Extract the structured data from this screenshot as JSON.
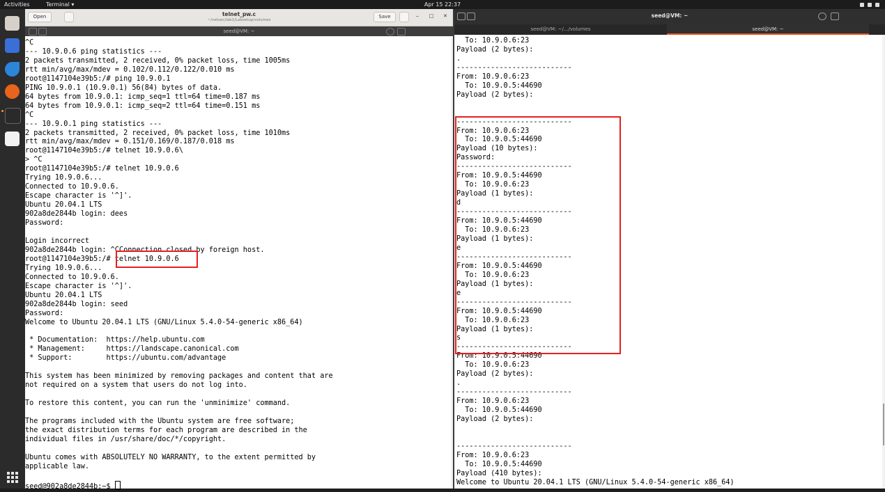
{
  "topbar": {
    "activities": "Activities",
    "app_menu": "Terminal ▾",
    "clock": "Apr 15  22:37"
  },
  "gedit": {
    "open_label": "Open",
    "title": "telnet_pw.c",
    "subtitle": "~/netsec/lab1/Labsetup/volumes",
    "save_label": "Save"
  },
  "left_terminal": {
    "title": "seed@VM: ~",
    "prompt": "seed@902a8de2844b:~$ ",
    "lines": [
      "^C",
      "--- 10.9.0.6 ping statistics ---",
      "2 packets transmitted, 2 received, 0% packet loss, time 1005ms",
      "rtt min/avg/max/mdev = 0.102/0.112/0.122/0.010 ms",
      "root@1147104e39b5:/# ping 10.9.0.1",
      "PING 10.9.0.1 (10.9.0.1) 56(84) bytes of data.",
      "64 bytes from 10.9.0.1: icmp_seq=1 ttl=64 time=0.187 ms",
      "64 bytes from 10.9.0.1: icmp_seq=2 ttl=64 time=0.151 ms",
      "^C",
      "--- 10.9.0.1 ping statistics ---",
      "2 packets transmitted, 2 received, 0% packet loss, time 1010ms",
      "rtt min/avg/max/mdev = 0.151/0.169/0.187/0.018 ms",
      "root@1147104e39b5:/# telnet 10.9.0.6\\",
      "> ^C",
      "root@1147104e39b5:/# telnet 10.9.0.6",
      "Trying 10.9.0.6...",
      "Connected to 10.9.0.6.",
      "Escape character is '^]'.",
      "Ubuntu 20.04.1 LTS",
      "902a8de2844b login: dees",
      "Password:",
      "",
      "Login incorrect",
      "902a8de2844b login: ^CConnection closed by foreign host.",
      "root@1147104e39b5:/# telnet 10.9.0.6",
      "Trying 10.9.0.6...",
      "Connected to 10.9.0.6.",
      "Escape character is '^]'.",
      "Ubuntu 20.04.1 LTS",
      "902a8de2844b login: seed",
      "Password:",
      "Welcome to Ubuntu 20.04.1 LTS (GNU/Linux 5.4.0-54-generic x86_64)",
      "",
      " * Documentation:  https://help.ubuntu.com",
      " * Management:     https://landscape.canonical.com",
      " * Support:        https://ubuntu.com/advantage",
      "",
      "This system has been minimized by removing packages and content that are",
      "not required on a system that users do not log into.",
      "",
      "To restore this content, you can run the 'unminimize' command.",
      "",
      "The programs included with the Ubuntu system are free software;",
      "the exact distribution terms for each program are described in the",
      "individual files in /usr/share/doc/*/copyright.",
      "",
      "Ubuntu comes with ABSOLUTELY NO WARRANTY, to the extent permitted by",
      "applicable law.",
      ""
    ]
  },
  "right_terminal": {
    "title": "seed@VM: ~",
    "tab1": "seed@VM: ~/.../volumes",
    "tab2": "seed@VM: ~",
    "lines": [
      "  To: 10.9.0.6:23",
      "Payload (2 bytes):",
      ".",
      "---------------------------",
      "From: 10.9.0.6:23",
      "  To: 10.9.0.5:44690",
      "Payload (2 bytes):",
      "",
      "",
      "---------------------------",
      "From: 10.9.0.6:23",
      "  To: 10.9.0.5:44690",
      "Payload (10 bytes):",
      "Password:",
      "---------------------------",
      "From: 10.9.0.5:44690",
      "  To: 10.9.0.6:23",
      "Payload (1 bytes):",
      "d",
      "---------------------------",
      "From: 10.9.0.5:44690",
      "  To: 10.9.0.6:23",
      "Payload (1 bytes):",
      "e",
      "---------------------------",
      "From: 10.9.0.5:44690",
      "  To: 10.9.0.6:23",
      "Payload (1 bytes):",
      "e",
      "---------------------------",
      "From: 10.9.0.5:44690",
      "  To: 10.9.0.6:23",
      "Payload (1 bytes):",
      "s",
      "---------------------------",
      "From: 10.9.0.5:44690",
      "  To: 10.9.0.6:23",
      "Payload (2 bytes):",
      ".",
      "---------------------------",
      "From: 10.9.0.6:23",
      "  To: 10.9.0.5:44690",
      "Payload (2 bytes):",
      "",
      "",
      "---------------------------",
      "From: 10.9.0.6:23",
      "  To: 10.9.0.5:44690",
      "Payload (410 bytes):",
      "Welcome to Ubuntu 20.04.1 LTS (GNU/Linux 5.4.0-54-generic x86_64)"
    ]
  },
  "colors": {
    "highlight": "#e41f1f",
    "ubuntu_orange": "#e95420"
  }
}
